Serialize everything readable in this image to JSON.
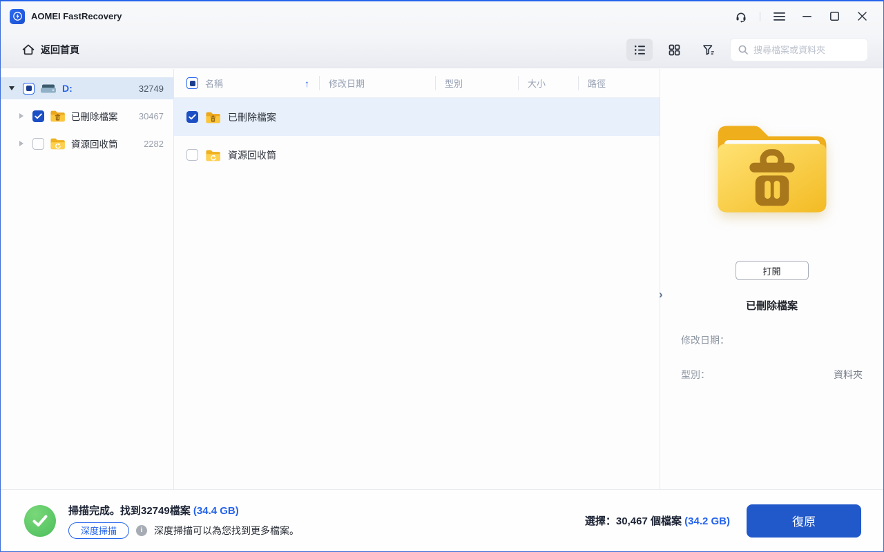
{
  "window": {
    "title": "AOMEI FastRecovery"
  },
  "toolbar": {
    "back_home": "返回首頁",
    "search_placeholder": "搜尋檔案或資料夾"
  },
  "sidebar": {
    "drive": {
      "label": "D:",
      "count": "32749",
      "state": "indeterminate"
    },
    "items": [
      {
        "label": "已刪除檔案",
        "count": "30467",
        "checked": true,
        "icon": "folder-trash-icon"
      },
      {
        "label": "資源回收筒",
        "count": "2282",
        "checked": false,
        "icon": "folder-recycle-icon"
      }
    ]
  },
  "table": {
    "columns": [
      "名稱",
      "修改日期",
      "型別",
      "大小",
      "路徑"
    ],
    "sort": {
      "column": "名稱",
      "direction": "asc",
      "arrow": "↑"
    },
    "rows": [
      {
        "name": "已刪除檔案",
        "checked": true,
        "selected": true,
        "icon": "folder-trash-icon"
      },
      {
        "name": "資源回收筒",
        "checked": false,
        "selected": false,
        "icon": "folder-recycle-icon"
      }
    ]
  },
  "details": {
    "open_button": "打開",
    "file_name": "已刪除檔案",
    "modified_label": "修改日期：",
    "type_label": "型別：",
    "type_value": "資料夾"
  },
  "statusbar": {
    "scan_text": "掃描完成。找到32749檔案",
    "scan_size": "(34.4 GB)",
    "deep_scan_button": "深度掃描",
    "info_glyph": "i",
    "deep_scan_hint": "深度掃描可以為您找到更多檔案。",
    "selection_text": "選擇：30,467 個檔案",
    "selection_size": "(34.2 GB)",
    "recover_button": "復原"
  },
  "colors": {
    "accent_blue": "#2563eb",
    "recover_button_blue": "#2158ca",
    "success_green": "#4cbe5c",
    "folder_yellow": "#f7c531",
    "selected_row_blue": "#e7f0fb"
  }
}
